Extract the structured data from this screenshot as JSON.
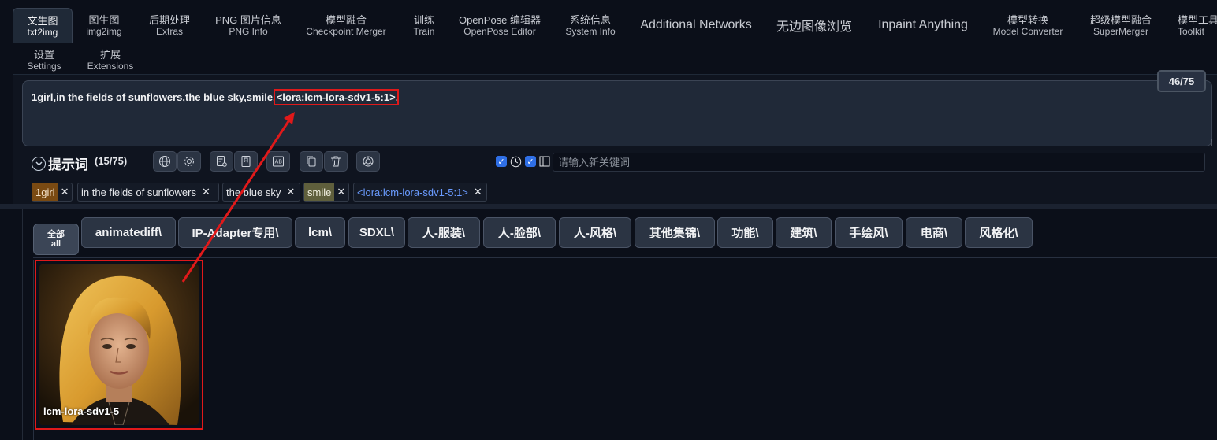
{
  "tabs": [
    {
      "zh": "文生图",
      "en": "txt2img",
      "active": true
    },
    {
      "zh": "图生图",
      "en": "img2img"
    },
    {
      "zh": "后期处理",
      "en": "Extras"
    },
    {
      "zh": "PNG 图片信息",
      "en": "PNG Info"
    },
    {
      "zh": "模型融合",
      "en": "Checkpoint Merger"
    },
    {
      "zh": "训练",
      "en": "Train"
    },
    {
      "zh": "OpenPose 编辑器",
      "en": "OpenPose Editor"
    },
    {
      "zh": "系统信息",
      "en": "System Info"
    },
    {
      "single": "Additional Networks"
    },
    {
      "single": "无边图像浏览"
    },
    {
      "single": "Inpaint Anything"
    },
    {
      "zh": "模型转换",
      "en": "Model Converter"
    },
    {
      "zh": "超级模型融合",
      "en": "SuperMerger"
    },
    {
      "zh": "模型工具",
      "en": "Toolkit"
    },
    {
      "zh": "设置",
      "en": "Settings"
    },
    {
      "zh": "扩展",
      "en": "Extensions"
    }
  ],
  "prompt": {
    "text_before": "1girl,in the fields of sunflowers,the blue sky,smile,",
    "lora_text": "<lora:lcm-lora-sdv1-5:1>",
    "text_after": ",",
    "token_count": "46/75"
  },
  "toolbar": {
    "title": "提示词",
    "count": "(15/75)",
    "keyword_placeholder": "请输入新关键词",
    "icons": [
      "globe-icon",
      "gear-icon",
      "doc-settings-icon",
      "bookmark-icon",
      "translate-icon",
      "copy-icon",
      "trash-icon",
      "openai-icon"
    ]
  },
  "tags": [
    {
      "label": "1girl",
      "style": "orange"
    },
    {
      "label": "in the fields of sunflowers",
      "style": "plain"
    },
    {
      "label": "the blue sky",
      "style": "plain"
    },
    {
      "label": "smile",
      "style": "olive"
    },
    {
      "label": "<lora:lcm-lora-sdv1-5:1>",
      "style": "blue"
    }
  ],
  "categories": {
    "all_zh": "全部",
    "all_en": "all",
    "items": [
      "animatediff\\",
      "IP-Adapter专用\\",
      "lcm\\",
      "SDXL\\",
      "人-服装\\",
      "人-脸部\\",
      "人-风格\\",
      "其他集锦\\",
      "功能\\",
      "建筑\\",
      "手绘风\\",
      "电商\\",
      "风格化\\"
    ]
  },
  "card": {
    "name": "lcm-lora-sdv1-5"
  },
  "colors": {
    "accent_red": "#e0191a",
    "bg": "#0b0f19",
    "checkbox_blue": "#2f6fe5"
  }
}
